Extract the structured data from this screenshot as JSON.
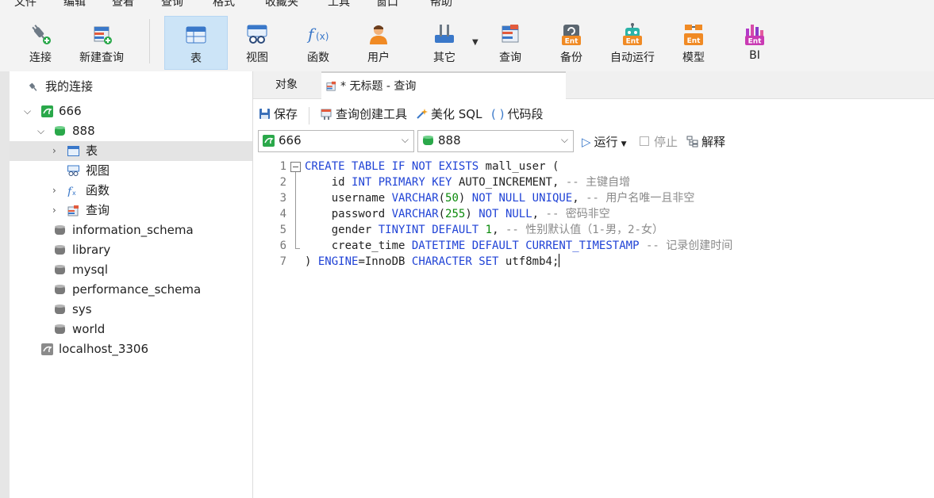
{
  "menu": [
    "文件",
    "编辑",
    "查看",
    "查询",
    "格式",
    "收藏夹",
    "工具",
    "窗口",
    "帮助"
  ],
  "toolbar": {
    "items": [
      {
        "label": "连接",
        "icon": "plug-icon"
      },
      {
        "label": "新建查询",
        "icon": "new-query-icon"
      },
      {
        "label": "表",
        "icon": "table-icon"
      },
      {
        "label": "视图",
        "icon": "view-icon"
      },
      {
        "label": "函数",
        "icon": "function-icon"
      },
      {
        "label": "用户",
        "icon": "user-icon"
      },
      {
        "label": "其它",
        "icon": "tools-icon"
      },
      {
        "label": "查询",
        "icon": "query-icon"
      },
      {
        "label": "备份",
        "icon": "backup-icon"
      },
      {
        "label": "自动运行",
        "icon": "robot-icon"
      },
      {
        "label": "模型",
        "icon": "model-icon"
      },
      {
        "label": "BI",
        "icon": "bi-icon"
      }
    ],
    "ent_badge": "Ent"
  },
  "sidebar": {
    "header": "我的连接",
    "tree": [
      {
        "label": "666",
        "type": "connection"
      },
      {
        "label": "888",
        "type": "database"
      },
      {
        "label": "表",
        "type": "tables"
      },
      {
        "label": "视图",
        "type": "views"
      },
      {
        "label": "函数",
        "type": "functions"
      },
      {
        "label": "查询",
        "type": "queries"
      },
      {
        "label": "information_schema",
        "type": "database"
      },
      {
        "label": "library",
        "type": "database"
      },
      {
        "label": "mysql",
        "type": "database"
      },
      {
        "label": "performance_schema",
        "type": "database"
      },
      {
        "label": "sys",
        "type": "database"
      },
      {
        "label": "world",
        "type": "database"
      },
      {
        "label": "localhost_3306",
        "type": "connection"
      }
    ]
  },
  "tabs": {
    "objects": "对象",
    "query": "* 无标题 - 查询"
  },
  "query_toolbar": {
    "save": "保存",
    "builder": "查询创建工具",
    "beautify": "美化 SQL",
    "snippet": "代码段"
  },
  "selectors": {
    "connection": "666",
    "database": "888",
    "run": "运行",
    "stop": "停止",
    "explain": "解释"
  },
  "editor": {
    "line_numbers": [
      "1",
      "2",
      "3",
      "4",
      "5",
      "6",
      "7"
    ],
    "lines": [
      "CREATE TABLE IF NOT EXISTS mall_user (",
      "    id INT PRIMARY KEY AUTO_INCREMENT, -- 主键自增",
      "    username VARCHAR(50) NOT NULL UNIQUE, -- 用户名唯一且非空",
      "    password VARCHAR(255) NOT NULL, -- 密码非空",
      "    gender TINYINT DEFAULT 1, -- 性别默认值（1-男，2-女）",
      "    create_time DATETIME DEFAULT CURRENT_TIMESTAMP -- 记录创建时间",
      ") ENGINE=InnoDB CHARACTER SET utf8mb4;"
    ]
  },
  "colors": {
    "keyword": "#2043d6",
    "number": "#0a8a0a",
    "comment": "#8a8a8a",
    "selection": "#cce4f7"
  }
}
